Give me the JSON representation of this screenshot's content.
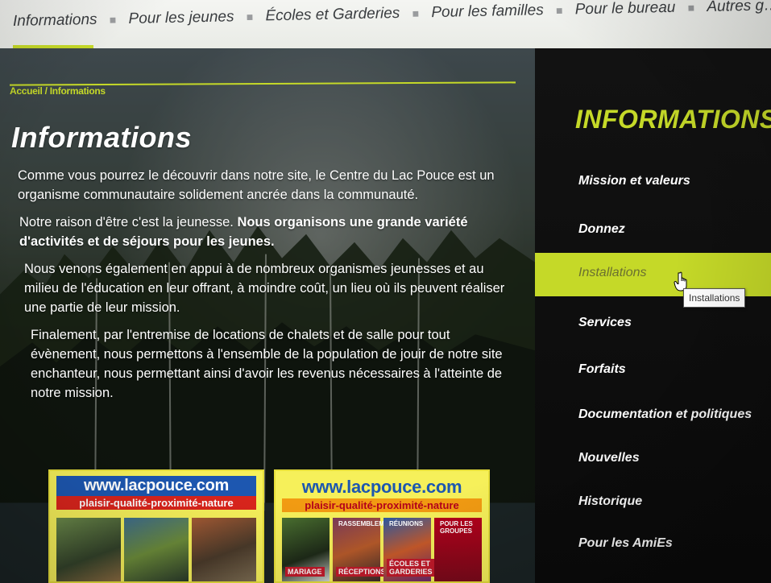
{
  "nav": {
    "items": [
      {
        "label": "Informations",
        "active": true
      },
      {
        "label": "Pour les jeunes",
        "active": false
      },
      {
        "label": "Écoles et Garderies",
        "active": false
      },
      {
        "label": "Pour les familles",
        "active": false
      },
      {
        "label": "Pour le bureau",
        "active": false
      },
      {
        "label": "Autres g…",
        "active": false
      }
    ],
    "separator": "■",
    "accent_color": "#c5d928"
  },
  "breadcrumb": "Accueil / Informations",
  "page_title": "Informations",
  "paragraphs": [
    "Comme vous pourrez le découvrir dans notre site, le Centre du Lac Pouce est un organisme communautaire solidement ancrée dans la communauté.",
    "Nous venons également en appui à de nombreux organismes jeunesses et au milieu de l'éducation en leur offrant, à moindre coût, un lieu où ils peuvent réaliser une partie de leur mission.",
    "Finalement, par l'entremise de locations de chalets et de salle pour tout évènement, nous permettons à l'ensemble de la population de jouir de notre site enchanteur, nous permettant ainsi d'avoir les revenus nécessaires à l'atteinte de notre mission."
  ],
  "mission_paragraph": {
    "part1": "Notre raison d'être c'est la jeunesse. ",
    "part2_bold": "Nous organisons une grande variété d'activités et de séjours pour les jeunes."
  },
  "ads": [
    {
      "url": "www.lacpouce.com",
      "tagline": "plaisir-qualité-proximité-nature"
    },
    {
      "url": "www.lacpouce.com",
      "tagline": "plaisir-qualité-proximité-nature",
      "labels": [
        "RASSEMBLEMENTS",
        "RÉUNIONS",
        "POUR LES GROUPES",
        "MARIAGE",
        "RÉCEPTIONS",
        "ÉCOLES ET GARDERIES"
      ]
    }
  ],
  "sidebar": {
    "title": "INFORMATIONS",
    "items": [
      {
        "label": "Mission et valeurs",
        "active": false
      },
      {
        "label": "Donnez",
        "active": false
      },
      {
        "label": "Installations",
        "active": true
      },
      {
        "label": "Services",
        "active": false
      },
      {
        "label": "Forfaits",
        "active": false
      },
      {
        "label": "Documentation et politiques",
        "active": false
      },
      {
        "label": "Nouvelles",
        "active": false
      },
      {
        "label": "Historique",
        "active": false
      },
      {
        "label": "Pour les AmiEs",
        "active": false
      }
    ]
  },
  "tooltip": "Installations"
}
